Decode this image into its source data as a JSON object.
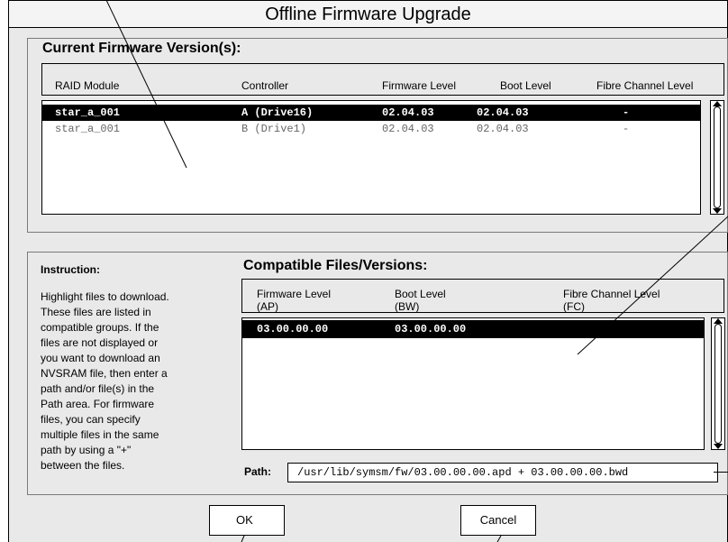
{
  "window": {
    "title": "Offline Firmware Upgrade"
  },
  "current": {
    "heading": "Current Firmware Version(s):",
    "columns": [
      "RAID Module",
      "Controller",
      "Firmware Level",
      "Boot Level",
      "Fibre Channel Level"
    ],
    "rows": [
      {
        "module": "star_a_001",
        "controller": "A (Drive16)",
        "firmware": "02.04.03",
        "boot": "02.04.03",
        "fc": "-",
        "selected": true
      },
      {
        "module": "star_a_001",
        "controller": "B (Drive1)",
        "firmware": "02.04.03",
        "boot": "02.04.03",
        "fc": "-",
        "selected": false
      }
    ]
  },
  "instruction": {
    "title": "Instruction:",
    "lines": [
      "Highlight files to download.",
      "These files are listed in",
      "compatible groups. If the",
      "files are not displayed or",
      "you want to download an",
      "NVSRAM file, then enter a",
      "path and/or file(s) in the",
      "Path area. For firmware",
      "files, you can specify",
      "multiple files in the same",
      "path by using a \"+\"",
      "between the files."
    ]
  },
  "compatible": {
    "heading": "Compatible Files/Versions:",
    "columns": [
      {
        "line1": "Firmware Level",
        "line2": "(AP)"
      },
      {
        "line1": "Boot Level",
        "line2": "(BW)"
      },
      {
        "line1": "Fibre Channel Level",
        "line2": "(FC)"
      }
    ],
    "rows": [
      {
        "firmware": "03.00.00.00",
        "boot": "03.00.00.00",
        "fc": "",
        "selected": true
      }
    ]
  },
  "path": {
    "label": "Path:",
    "value": "/usr/lib/symsm/fw/03.00.00.00.apd + 03.00.00.00.bwd"
  },
  "buttons": {
    "ok": "OK",
    "cancel": "Cancel"
  }
}
